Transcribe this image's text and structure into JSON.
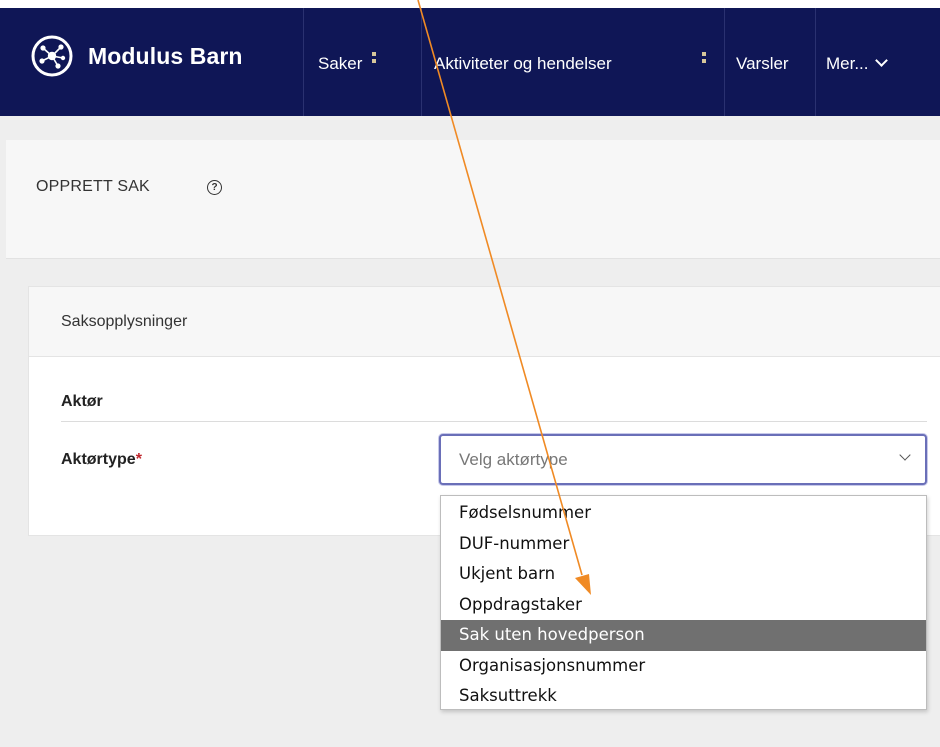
{
  "app": {
    "name": "Modulus Barn",
    "logo_icon": "network-hub-icon"
  },
  "nav": {
    "items": [
      {
        "label": "Saker"
      },
      {
        "label": "Aktiviteter og hendelser"
      },
      {
        "label": "Varsler"
      },
      {
        "label": "Mer..."
      }
    ],
    "more_icon": "chevron-down-icon"
  },
  "page": {
    "title": "OPPRETT SAK",
    "help_glyph": "?",
    "help_icon": "question-circle-icon"
  },
  "card": {
    "title": "Saksopplysninger",
    "section_label": "Aktør",
    "field_label": "Aktørtype",
    "required_mark": "*"
  },
  "select": {
    "placeholder": "Velg aktørtype",
    "options": [
      "Fødselsnummer",
      "DUF-nummer",
      "Ukjent barn",
      "Oppdragstaker",
      "Sak uten hovedperson",
      "Organisasjonsnummer",
      "Saksuttrekk"
    ],
    "highlighted_option": "Sak uten hovedperson"
  },
  "colors": {
    "topbar": "#0f1656",
    "accent_select_border": "#6a6fb8",
    "highlight_option_bg": "#707070",
    "required": "#c0262d",
    "annotation_arrow": "#f08a24"
  }
}
